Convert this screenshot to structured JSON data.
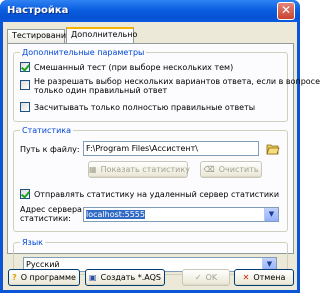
{
  "window": {
    "title": "Настройка",
    "close_symbol": "✕"
  },
  "tabs": [
    {
      "label": "Тестирование",
      "active": false
    },
    {
      "label": "Дополнительно",
      "active": true
    }
  ],
  "extra_params": {
    "title": "Дополнительные параметры",
    "options": [
      {
        "label": "Смешанный тест (при выборе нескольких тем)",
        "checked": true
      },
      {
        "label_line1": "Не разрешать выбор нескольких вариантов ответа, если в вопросе",
        "label_line2": "только один правильный ответ",
        "checked": false
      },
      {
        "label": "Засчитывать только полностью правильные ответы",
        "checked": false
      }
    ]
  },
  "statistics": {
    "title": "Статистика",
    "path_label": "Путь к файлу:",
    "path_value": "F:\\Program Files\\Ассистент\\",
    "show_button": "Показать статистику",
    "clear_button": "Очистить",
    "send_label": "Отправлять статистику на удаленный сервер статистики",
    "send_checked": true,
    "server_label_line1": "Адрес сервера",
    "server_label_line2": "статистики:",
    "server_value": "localhost:5555"
  },
  "language": {
    "title": "Язык",
    "selected": "Русский"
  },
  "buttons": {
    "about": "О программе",
    "create": "Создать *.AQS",
    "ok": "OK",
    "cancel": "Отмена"
  },
  "icons": {
    "help": "question-icon",
    "save": "floppy-icon",
    "ok": "checkmark-icon",
    "cancel": "x-icon",
    "folder": "folder-icon",
    "dropdown": "chevron-down-icon"
  },
  "colors": {
    "titlebar": "#0b5ee0",
    "group_title": "#0046d5",
    "selection": "#316ac5",
    "cancel_icon": "#cc2200",
    "help_icon": "#e0a000"
  }
}
